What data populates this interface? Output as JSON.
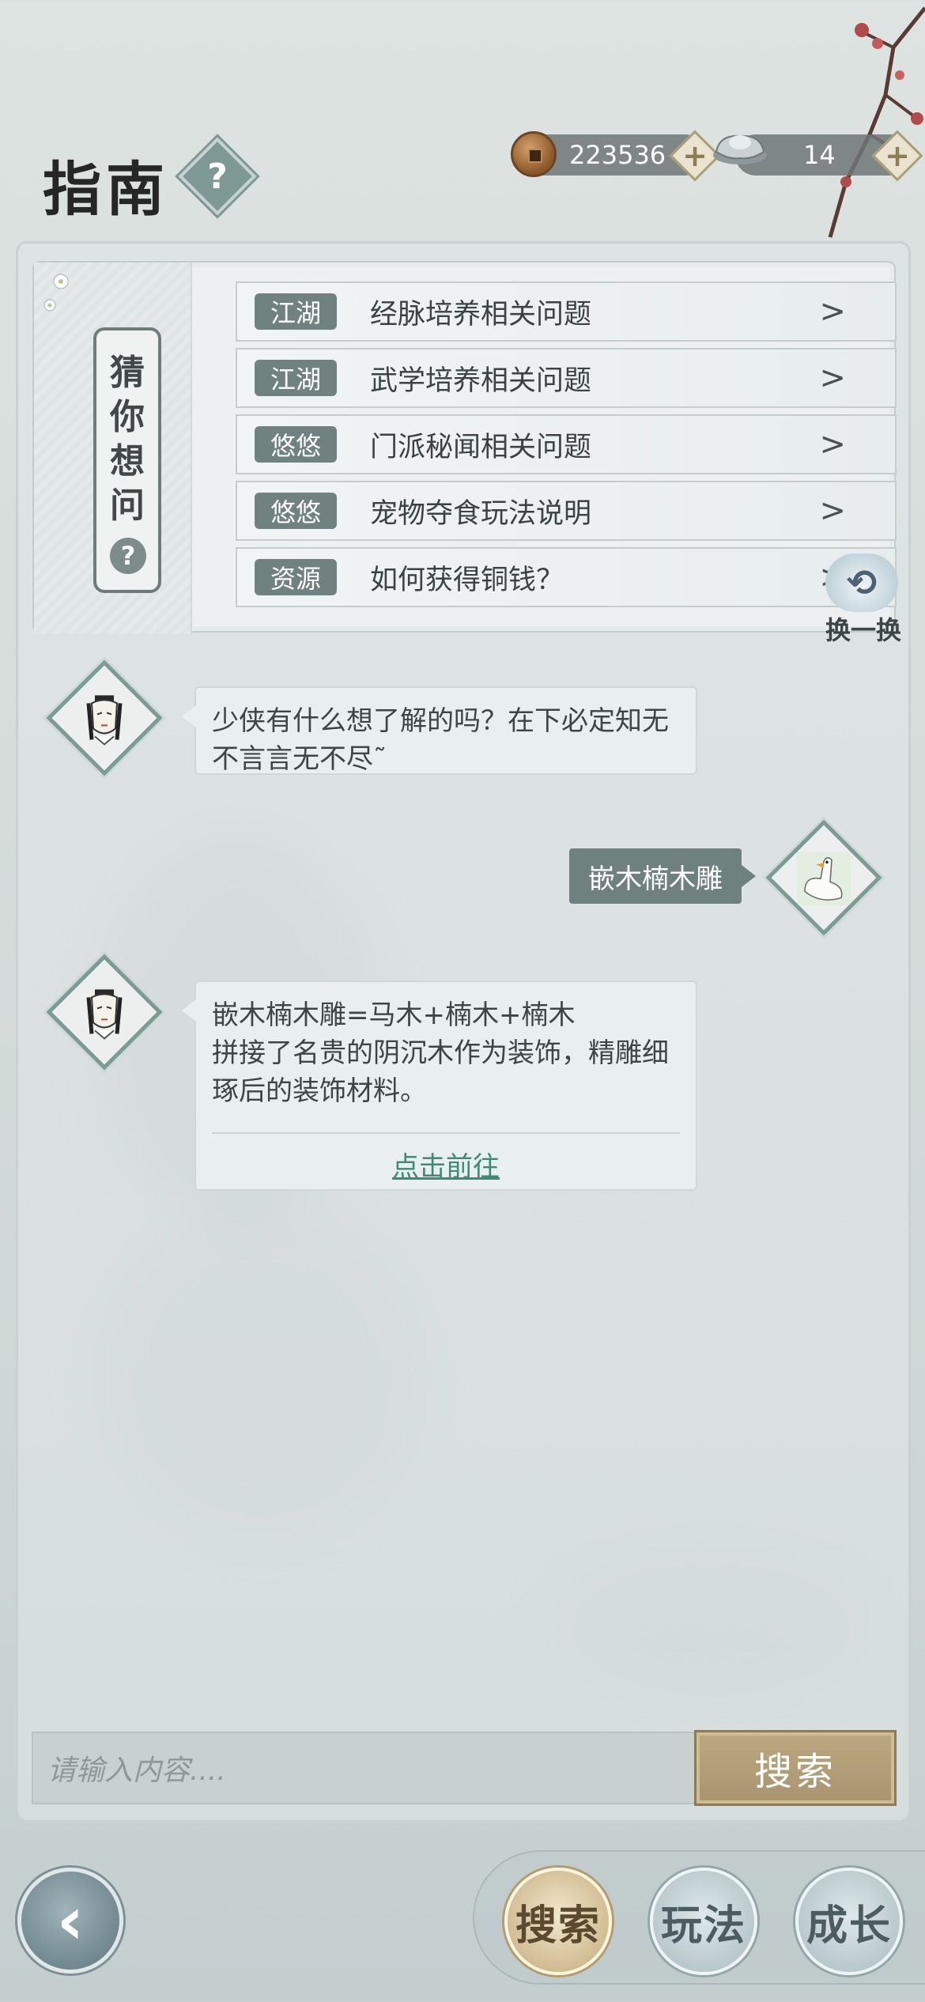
{
  "header": {
    "title": "指南",
    "help_icon": "?"
  },
  "currency": {
    "copper_amount": "223536",
    "silver_amount": "14"
  },
  "guess": {
    "label": "猜你想问",
    "items": [
      {
        "tag": "江湖",
        "text": "经脉培养相关问题"
      },
      {
        "tag": "江湖",
        "text": "武学培养相关问题"
      },
      {
        "tag": "悠悠",
        "text": "门派秘闻相关问题"
      },
      {
        "tag": "悠悠",
        "text": "宠物夺食玩法说明"
      },
      {
        "tag": "资源",
        "text": "如何获得铜钱？"
      }
    ],
    "refresh_label": "换一换"
  },
  "chat": {
    "greeting_line1": "少侠有什么想了解的吗？在下必定知无",
    "greeting_line2": "不言言无不尽˜",
    "user_query": "嵌木楠木雕",
    "answer_line1": "嵌木楠木雕=马木+楠木+楠木",
    "answer_line2": "拼接了名贵的阴沉木作为装饰，精雕细",
    "answer_line3": "琢后的装饰材料。",
    "answer_link": "点击前往"
  },
  "search": {
    "placeholder": "请输入内容....",
    "button_label": "搜索"
  },
  "nav": {
    "search": "搜索",
    "gameplay": "玩法",
    "growth": "成长"
  },
  "colors": {
    "accent_green": "#6f8280",
    "link_green": "#3e8a72",
    "gold_button": "#a89570"
  }
}
